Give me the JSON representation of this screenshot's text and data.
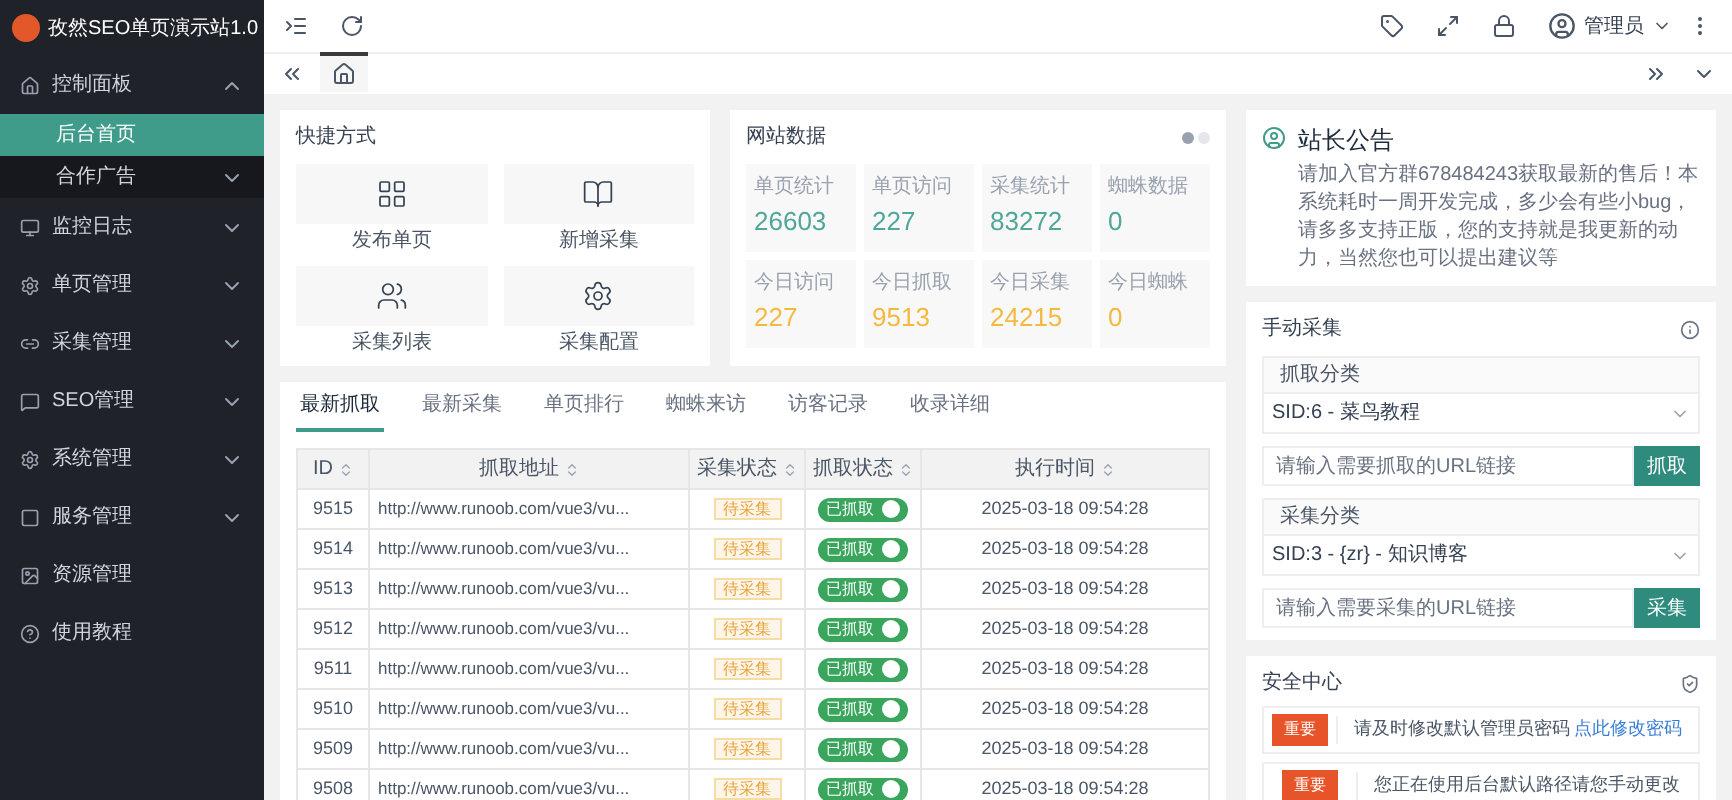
{
  "sidebar": {
    "title": "孜然SEO单页演示站1.0",
    "items": [
      {
        "label": "控制面板",
        "kind": "menu",
        "expanded": true,
        "children": [
          {
            "label": "后台首页",
            "selected": true,
            "kind": "link"
          },
          {
            "label": "合作广告",
            "selected": false,
            "kind": "menu"
          }
        ]
      },
      {
        "label": "监控日志",
        "kind": "menu",
        "expanded": false
      },
      {
        "label": "单页管理",
        "kind": "menu",
        "expanded": false
      },
      {
        "label": "采集管理",
        "kind": "menu",
        "expanded": false
      },
      {
        "label": "SEO管理",
        "kind": "menu",
        "expanded": false
      },
      {
        "label": "系统管理",
        "kind": "menu",
        "expanded": false
      },
      {
        "label": "服务管理",
        "kind": "menu",
        "expanded": false
      },
      {
        "label": "资源管理",
        "kind": "link"
      },
      {
        "label": "使用教程",
        "kind": "link"
      }
    ]
  },
  "topbar": {
    "user": "管理员"
  },
  "shortcuts": {
    "title": "快捷方式",
    "items": [
      {
        "label": "发布单页"
      },
      {
        "label": "新增采集"
      },
      {
        "label": "采集列表"
      },
      {
        "label": "采集配置"
      }
    ]
  },
  "site_data": {
    "title": "网站数据",
    "stats": [
      {
        "label": "单页统计",
        "value": "26603",
        "color": "#4fa79a"
      },
      {
        "label": "单页访问",
        "value": "227",
        "color": "#4fa79a"
      },
      {
        "label": "采集统计",
        "value": "83272",
        "color": "#4fa79a"
      },
      {
        "label": "蜘蛛数据",
        "value": "0",
        "color": "#4fa79a"
      },
      {
        "label": "今日访问",
        "value": "227",
        "color": "#f5b941"
      },
      {
        "label": "今日抓取",
        "value": "9513",
        "color": "#f5b941"
      },
      {
        "label": "今日采集",
        "value": "24215",
        "color": "#f5b941"
      },
      {
        "label": "今日蜘蛛",
        "value": "0",
        "color": "#f5b941"
      }
    ]
  },
  "tabs": [
    {
      "label": "最新抓取",
      "selected": true
    },
    {
      "label": "最新采集",
      "selected": false
    },
    {
      "label": "单页排行",
      "selected": false
    },
    {
      "label": "蜘蛛来访",
      "selected": false
    },
    {
      "label": "访客记录",
      "selected": false
    },
    {
      "label": "收录详细",
      "selected": false
    }
  ],
  "table": {
    "columns": [
      "ID",
      "抓取地址",
      "采集状态",
      "抓取状态",
      "执行时间"
    ],
    "rows": [
      {
        "id": "9515",
        "url": "http://www.runoob.com/vue3/vu...",
        "collect": "待采集",
        "crawl": "已抓取",
        "on": true,
        "time": "2025-03-18 09:54:28"
      },
      {
        "id": "9514",
        "url": "http://www.runoob.com/vue3/vu...",
        "collect": "待采集",
        "crawl": "已抓取",
        "on": true,
        "time": "2025-03-18 09:54:28"
      },
      {
        "id": "9513",
        "url": "http://www.runoob.com/vue3/vu...",
        "collect": "待采集",
        "crawl": "已抓取",
        "on": true,
        "time": "2025-03-18 09:54:28"
      },
      {
        "id": "9512",
        "url": "http://www.runoob.com/vue3/vu...",
        "collect": "待采集",
        "crawl": "已抓取",
        "on": true,
        "time": "2025-03-18 09:54:28"
      },
      {
        "id": "9511",
        "url": "http://www.runoob.com/vue3/vu...",
        "collect": "待采集",
        "crawl": "已抓取",
        "on": true,
        "time": "2025-03-18 09:54:28"
      },
      {
        "id": "9510",
        "url": "http://www.runoob.com/vue3/vu...",
        "collect": "待采集",
        "crawl": "已抓取",
        "on": true,
        "time": "2025-03-18 09:54:28"
      },
      {
        "id": "9509",
        "url": "http://www.runoob.com/vue3/vu...",
        "collect": "待采集",
        "crawl": "已抓取",
        "on": true,
        "time": "2025-03-18 09:54:28"
      },
      {
        "id": "9508",
        "url": "http://www.runoob.com/vue3/vu...",
        "collect": "待采集",
        "crawl": "已抓取",
        "on": true,
        "time": "2025-03-18 09:54:28"
      }
    ]
  },
  "notice": {
    "title": "站长公告",
    "text": "请加入官方群678484243获取最新的售后！本系统耗时一周开发完成，多少会有些小bug，请多多支持正版，您的支持就是我更新的动力，当然您也可以提出建议等"
  },
  "manual": {
    "title": "手动采集",
    "groups": [
      {
        "label": "抓取分类",
        "select": "SID:6 - 菜鸟教程",
        "placeholder": "请输入需要抓取的URL链接",
        "button": "抓取"
      },
      {
        "label": "采集分类",
        "select": "SID:3 - {zr} - 知识博客",
        "placeholder": "请输入需要采集的URL链接",
        "button": "采集"
      }
    ]
  },
  "security": {
    "title": "安全中心",
    "rows": [
      {
        "badge": "重要",
        "text": "请及时修改默认管理员密码",
        "link": "点此修改密码"
      },
      {
        "badge": "重要",
        "text": "您正在使用后台默认路径请您手动更改",
        "link": ""
      }
    ]
  }
}
